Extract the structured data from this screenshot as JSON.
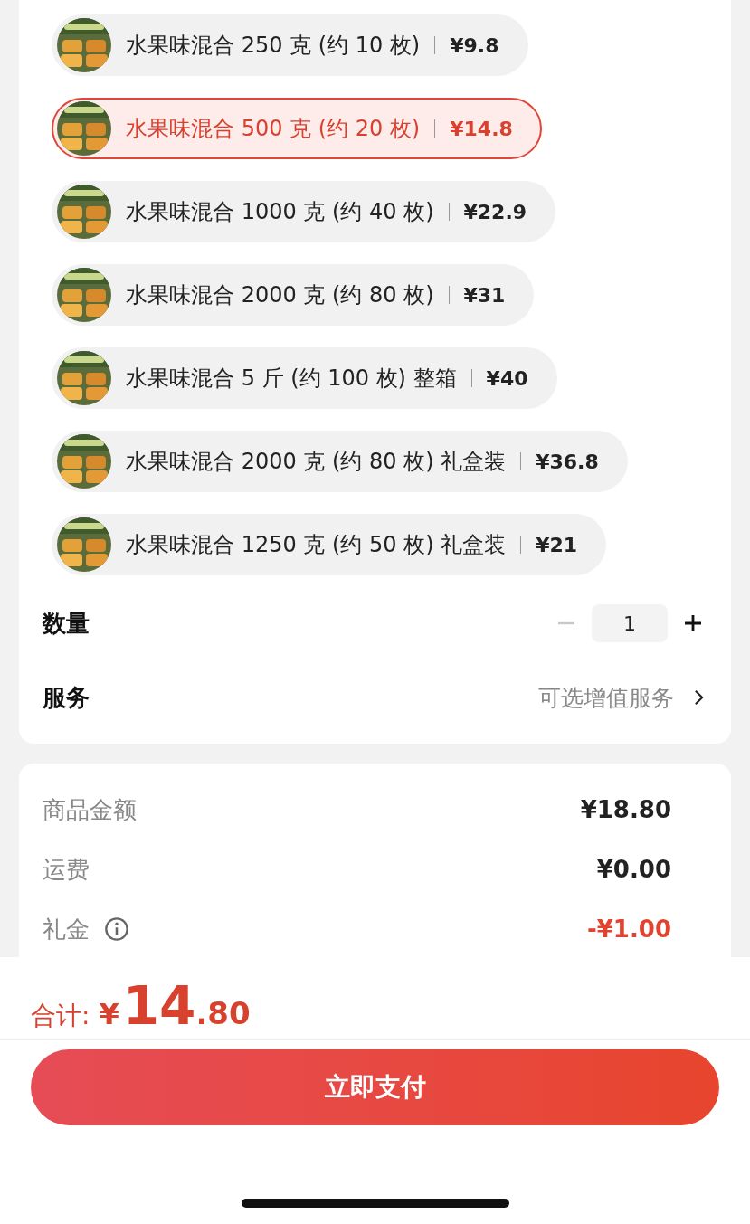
{
  "options": [
    {
      "label": "水果味混合 250 克 (约 10 枚)",
      "price": "¥9.8",
      "selected": false
    },
    {
      "label": "水果味混合 500 克 (约 20 枚)",
      "price": "¥14.8",
      "selected": true
    },
    {
      "label": "水果味混合 1000 克 (约 40 枚)",
      "price": "¥22.9",
      "selected": false
    },
    {
      "label": "水果味混合 2000 克 (约 80 枚)",
      "price": "¥31",
      "selected": false
    },
    {
      "label": "水果味混合 5 斤 (约 100 枚) 整箱",
      "price": "¥40",
      "selected": false
    },
    {
      "label": "水果味混合 2000 克 (约 80 枚) 礼盒装",
      "price": "¥36.8",
      "selected": false
    },
    {
      "label": "水果味混合 1250 克 (约 50 枚) 礼盒装",
      "price": "¥21",
      "selected": false
    }
  ],
  "quantity": {
    "label": "数量",
    "value": "1",
    "minus_disabled": true
  },
  "service": {
    "label": "服务",
    "hint": "可选增值服务"
  },
  "summary": [
    {
      "label": "商品金额",
      "value": "¥18.80",
      "discount": false,
      "info": false
    },
    {
      "label": "运费",
      "value": "¥0.00",
      "discount": false,
      "info": false
    },
    {
      "label": "礼金",
      "value": "-¥1.00",
      "discount": true,
      "info": true
    }
  ],
  "total": {
    "label": "合计:",
    "currency": "¥",
    "integer": "14",
    "decimal": ".80"
  },
  "pay_button": "立即支付"
}
